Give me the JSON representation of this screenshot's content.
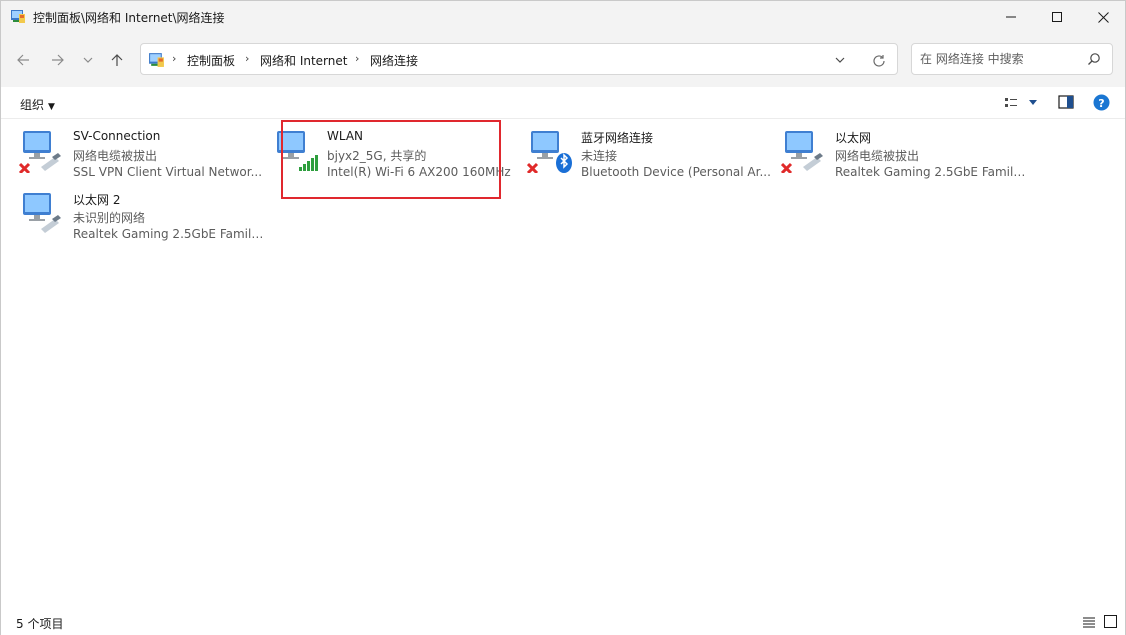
{
  "window": {
    "title": "控制面板\\网络和 Internet\\网络连接"
  },
  "address": {
    "breadcrumbs": [
      "控制面板",
      "网络和 Internet",
      "网络连接"
    ],
    "search_placeholder": "在 网络连接 中搜索"
  },
  "toolbar": {
    "organize_label": "组织"
  },
  "connections": [
    {
      "name": "SV-Connection",
      "status": "网络电缆被拔出",
      "device": "SSL VPN Client Virtual Networ...",
      "overlay": "disconnected-x-icon"
    },
    {
      "name": "WLAN",
      "status": "bjyx2_5G, 共享的",
      "device": "Intel(R) Wi-Fi 6 AX200 160MHz",
      "overlay": "signal-bars-icon"
    },
    {
      "name": "蓝牙网络连接",
      "status": "未连接",
      "device": "Bluetooth Device (Personal Ar...",
      "overlay": "bluetooth-icon"
    },
    {
      "name": "以太网",
      "status": "网络电缆被拔出",
      "device": "Realtek Gaming 2.5GbE Family...",
      "overlay": "disconnected-x-icon"
    },
    {
      "name": "以太网 2",
      "status": "未识别的网络",
      "device": "Realtek Gaming 2.5GbE Family...",
      "overlay": "none"
    }
  ],
  "statusbar": {
    "item_count": "5 个项目"
  },
  "colors": {
    "highlight": "#e0282e",
    "accent": "#0067c0"
  }
}
